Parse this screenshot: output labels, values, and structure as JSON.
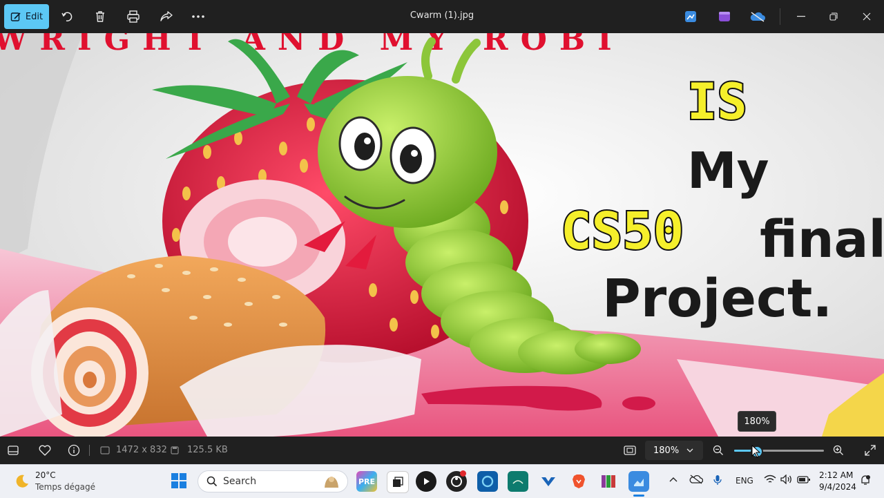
{
  "toolbar": {
    "edit_label": "Edit",
    "title": "Cwarm (1).jpg",
    "accent": "#5cc8f5"
  },
  "image": {
    "text_is": "IS",
    "text_my": "My",
    "text_cs50": "CS50",
    "text_final": "final",
    "text_project": "Project.",
    "text_top_banner": "WRIGHT AND MY ROBI"
  },
  "zoom_tooltip": "180%",
  "statusbar": {
    "dimensions": "1472 x 832",
    "file_size": "125.5 KB",
    "zoom_value": "180%",
    "zoom_slider_fraction": 0.25
  },
  "taskbar": {
    "weather_temp": "20°C",
    "weather_desc": "Temps dégagé",
    "search_placeholder": "Search",
    "language": "ENG",
    "time": "2:12 AM",
    "date": "9/4/2024"
  }
}
